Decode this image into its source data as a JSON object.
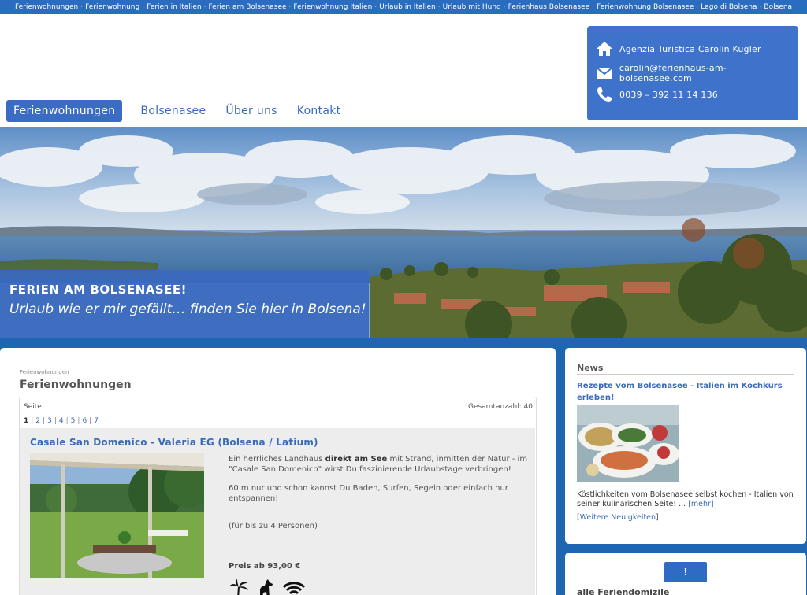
{
  "topstrip": {
    "links": [
      "Ferienwohnungen",
      "Ferienwohnung",
      "Ferien in Italien",
      "Ferien am Bolsenasee",
      "Ferienwohnung Italien",
      "Urlaub in Italien",
      "Urlaub mit Hund",
      "Ferienhaus Bolsenasee",
      "Ferienwohnung Bolsenasee",
      "Lago di Bolsena",
      "Bolsena"
    ],
    "separator": "·"
  },
  "nav": {
    "items": [
      {
        "label": "Ferienwohnungen",
        "active": true
      },
      {
        "label": "Bolsenasee",
        "active": false
      },
      {
        "label": "Über uns",
        "active": false
      },
      {
        "label": "Kontakt",
        "active": false
      }
    ]
  },
  "contact": {
    "agency": "Agenzia Turistica Carolin Kugler",
    "email": "carolin@ferienhaus-am-bolsenasee.com",
    "phone": "0039 – 392 11 14 136",
    "icons": [
      "home-icon",
      "mail-icon",
      "phone-icon"
    ]
  },
  "banner": {
    "line1": "FERIEN AM BOLSENASEE!",
    "line2": "Urlaub wie er mir gefällt… finden Sie hier in Bolsena!"
  },
  "main": {
    "breadcrumb": "Ferienwohnungen",
    "title": "Ferienwohnungen",
    "seite_label": "Seite:",
    "total_label": "Gesamtanzahl: 40",
    "pages": [
      "1",
      "2",
      "3",
      "4",
      "5",
      "6",
      "7"
    ],
    "current_page": "1",
    "listing": {
      "title": "Casale San Domenico - Valeria EG (Bolsena / Latium)",
      "desc_part1": "Ein herrliches Landhaus ",
      "desc_bold": "direkt am See",
      "desc_part2": " mit Strand, inmitten der Natur - im \"Casale San Domenico\" wirst Du faszinierende Urlaubstage verbringen!",
      "desc2": "60 m nur und schon kannst Du Baden, Surfen, Segeln oder einfach nur entspannen!",
      "persons": "(für bis zu 4 Personen)",
      "price": "Preis ab 93,00 €",
      "amenities": [
        "palm-icon",
        "dog-icon",
        "wifi-icon"
      ]
    }
  },
  "sidebar": {
    "news_heading": "News",
    "news_title": "Rezepte vom Bolsenasee - Italien im Kochkurs erleben!",
    "news_text": "Köstlichkeiten vom Bolsenasee selbst kochen - Italien von seiner kulinarischen Seite! ... ",
    "news_more": "[mehr]",
    "more_news_open": "[",
    "more_news": "Weitere Neuigkeiten",
    "more_news_close": "]",
    "button_label": "!",
    "all_label": "alle Feriendomizile"
  },
  "colors": {
    "brand_blue": "#3f73cb",
    "link_blue": "#3a6bb8",
    "background": "#1f66b0"
  }
}
